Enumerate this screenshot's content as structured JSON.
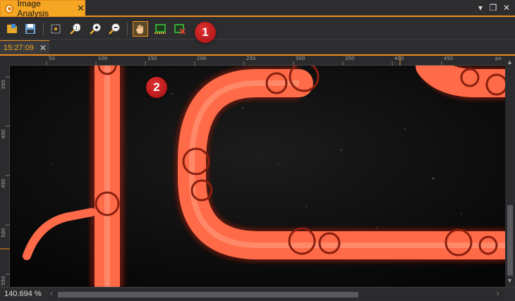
{
  "window": {
    "tab_title": "Image Analysis",
    "tab_close": "✕",
    "controls": {
      "menu": "▾",
      "restore": "❐",
      "close": "✕"
    }
  },
  "toolbar": {
    "buttons": [
      {
        "name": "open-image-button",
        "icon": "folder-icon"
      },
      {
        "name": "save-image-button",
        "icon": "save-icon"
      },
      {
        "name": "fit-to-window-button",
        "icon": "fit-icon"
      },
      {
        "name": "zoom-1-1-button",
        "icon": "zoom-actual-icon"
      },
      {
        "name": "zoom-in-button",
        "icon": "zoom-in-icon"
      },
      {
        "name": "zoom-out-button",
        "icon": "zoom-out-icon"
      },
      {
        "name": "pan-tool-button",
        "icon": "hand-icon",
        "active": true
      },
      {
        "name": "roi-select-button",
        "icon": "roi-icon"
      },
      {
        "name": "roi-clear-button",
        "icon": "roi-delete-icon"
      }
    ]
  },
  "badges": {
    "b1": "1",
    "b2": "2"
  },
  "subtab": {
    "label": "15:27:09",
    "close": "✕"
  },
  "ruler": {
    "h_labels": [
      "50",
      "100",
      "150",
      "200",
      "250",
      "300",
      "350",
      "400",
      "450",
      "px"
    ],
    "v_labels": [
      "350",
      "400",
      "450",
      "500",
      "550"
    ]
  },
  "status": {
    "zoom": "140.694 %"
  },
  "colors": {
    "accent": "#f08c1e",
    "badge": "#c0161a",
    "trace": "#ff6a48"
  }
}
